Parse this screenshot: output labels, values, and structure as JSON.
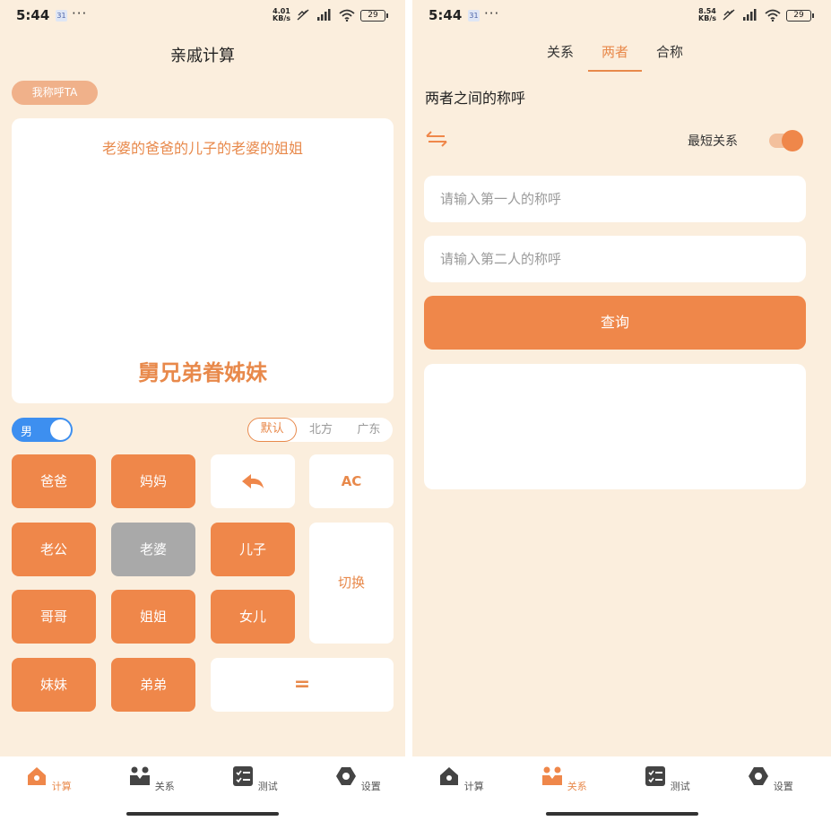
{
  "status_left": {
    "time": "5:44",
    "speed": "4.01\nKB/s",
    "dots": "···",
    "battery": "29"
  },
  "status_right": {
    "time": "5:44",
    "speed": "8.54\nKB/s",
    "dots": "···",
    "battery": "29"
  },
  "calc": {
    "title": "亲戚计算",
    "call_chip": "我称呼TA",
    "expression": "老婆的爸爸的儿子的老婆的姐姐",
    "result": "舅兄弟眷姊妹",
    "gender": "男",
    "dialects": [
      "默认",
      "北方",
      "广东"
    ],
    "keys": {
      "father": "爸爸",
      "mother": "妈妈",
      "back": "↶",
      "clear": "AC",
      "husband": "老公",
      "wife": "老婆",
      "son": "儿子",
      "switch": "切换",
      "elder_brother": "哥哥",
      "elder_sister": "姐姐",
      "daughter": "女儿",
      "younger_sister": "妹妹",
      "younger_brother": "弟弟",
      "equals": "="
    }
  },
  "relation": {
    "tabs": [
      "关系",
      "两者",
      "合称"
    ],
    "section_label": "两者之间的称呼",
    "shortest_label": "最短关系",
    "shortest_on": true,
    "first_placeholder": "请输入第一人的称呼",
    "second_placeholder": "请输入第二人的称呼",
    "query_label": "查询"
  },
  "tabbar": [
    "计算",
    "关系",
    "测试",
    "设置"
  ],
  "colors": {
    "accent": "#ef874a",
    "background": "#fbeedd",
    "toggle_blue": "#3d8ff0"
  }
}
